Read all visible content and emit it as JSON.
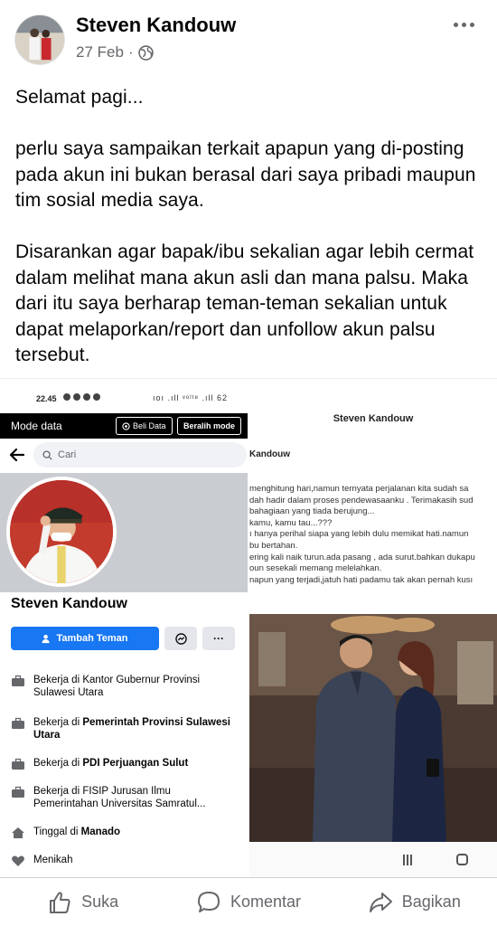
{
  "post": {
    "author": "Steven Kandouw",
    "date": "27 Feb",
    "separator": "·",
    "paragraphs": [
      "Selamat pagi...",
      "perlu saya sampaikan terkait apapun yang di-posting pada akun ini bukan berasal dari saya pribadi maupun tim sosial media saya.",
      "Disarankan agar bapak/ibu sekalian agar lebih cermat dalam melihat mana akun asli dan mana palsu. Maka dari itu saya berharap teman-teman sekalian untuk dapat melaporkan/report dan unfollow akun palsu tersebut."
    ]
  },
  "screenshot_left": {
    "time": "22.45",
    "status_right": "ıoı .ıll ᵛᵒˡᵗᵉ .ıll 62",
    "mode_label": "Mode data",
    "beli_label": "Beli Data",
    "beralih_label": "Beralih mode",
    "search_placeholder": "Cari",
    "profile_name": "Steven Kandouw",
    "add_friend_label": "Tambah Teman",
    "more_label": "···",
    "info": [
      {
        "prefix": "Bekerja di Kantor Gubernur Provinsi Sulawesi Utara",
        "bold": ""
      },
      {
        "prefix": "Bekerja di ",
        "bold": "Pemerintah Provinsi Sulawesi Utara"
      },
      {
        "prefix": "Bekerja di ",
        "bold": "PDI Perjuangan Sulut"
      },
      {
        "prefix": "Bekerja di FISIP Jurusan Ilmu Pemerintahan Universitas Samratul...",
        "bold": ""
      },
      {
        "prefix": "Tinggal di ",
        "bold": "Manado"
      },
      {
        "prefix": "Menikah",
        "bold": ""
      }
    ]
  },
  "screenshot_right": {
    "title": "Steven Kandouw",
    "subtitle": "Kandouw",
    "lines": [
      "menghitung hari,namun ternyata perjalanan kita sudah sa",
      "dah hadir dalam proses pendewasaanku . Terimakasih sud",
      "bahagiaan yang tiada berujung...",
      "kamu, kamu tau...???",
      "ı hanya perihal siapa yang lebih dulu memikat hati.namun",
      "bu bertahan.",
      "ering kali naik turun.ada pasang , ada surut.bahkan dukapu",
      "oun sesekali memang melelahkan.",
      "napun yang terjadi,jatuh hati padamu tak akan pernah kusı"
    ]
  },
  "actions": {
    "like": "Suka",
    "comment": "Komentar",
    "share": "Bagikan"
  },
  "colors": {
    "fb_blue": "#1877f2",
    "secondary_text": "#65676b"
  }
}
